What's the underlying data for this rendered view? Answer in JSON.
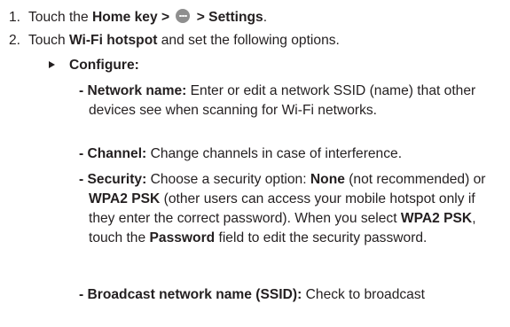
{
  "steps": [
    {
      "number": "1.",
      "text_1": "Touch the ",
      "home": "Home",
      "text_2": " key > ",
      "icon": "apps-menu-icon",
      "text_3": " > Settings",
      "text_4": "."
    },
    {
      "number": "2.",
      "text_1": "Touch ",
      "bold_1": "Wi-Fi hotspot",
      "text_2": " and set the following options."
    }
  ],
  "sub": {
    "bullet_icon": "triangle-bullet-icon",
    "label": "Configure:"
  },
  "options": [
    {
      "name": "- Network name:",
      "desc": " Enter or edit a network SSID (name) that other devices see when scanning for Wi-Fi networks."
    },
    {
      "name": "- Channel:",
      "desc": " Change channels in case of interference."
    },
    {
      "name": "- Security:",
      "desc_1": " Choose a security option: ",
      "none": "None",
      "desc_2": " (not recommended) or ",
      "wpa1": "WPA2 PSK",
      "desc_3": " (other users can access your mobile hotspot only if they enter the correct password). When you select ",
      "wpa2": "WPA2 PSK",
      "desc_4": ", touch the ",
      "password": "Password",
      "desc_5": " field to edit the security password."
    },
    {
      "name": "- Broadcast network name (SSID):",
      "desc": " Check to broadcast"
    }
  ]
}
